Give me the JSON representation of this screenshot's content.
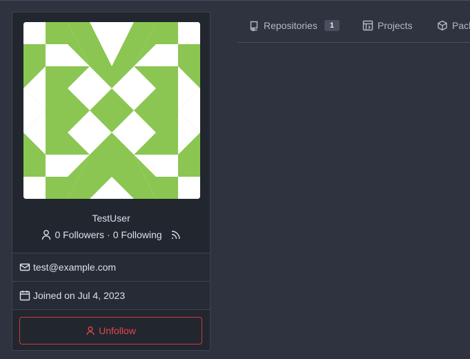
{
  "profile": {
    "username": "TestUser",
    "followers_text": "0 Followers",
    "separator": "·",
    "following_text": "0 Following",
    "email": "test@example.com",
    "joined": "Joined on Jul 4, 2023",
    "unfollow_label": "Unfollow",
    "avatar_color": "#8bc652"
  },
  "tabs": [
    {
      "label": "Repositories",
      "icon": "repo-icon",
      "count": "1"
    },
    {
      "label": "Projects",
      "icon": "project-icon"
    },
    {
      "label": "Pack",
      "icon": "package-icon"
    }
  ],
  "colors": {
    "background": "#2f323f",
    "card": "#22262f",
    "danger": "#e0494a"
  }
}
